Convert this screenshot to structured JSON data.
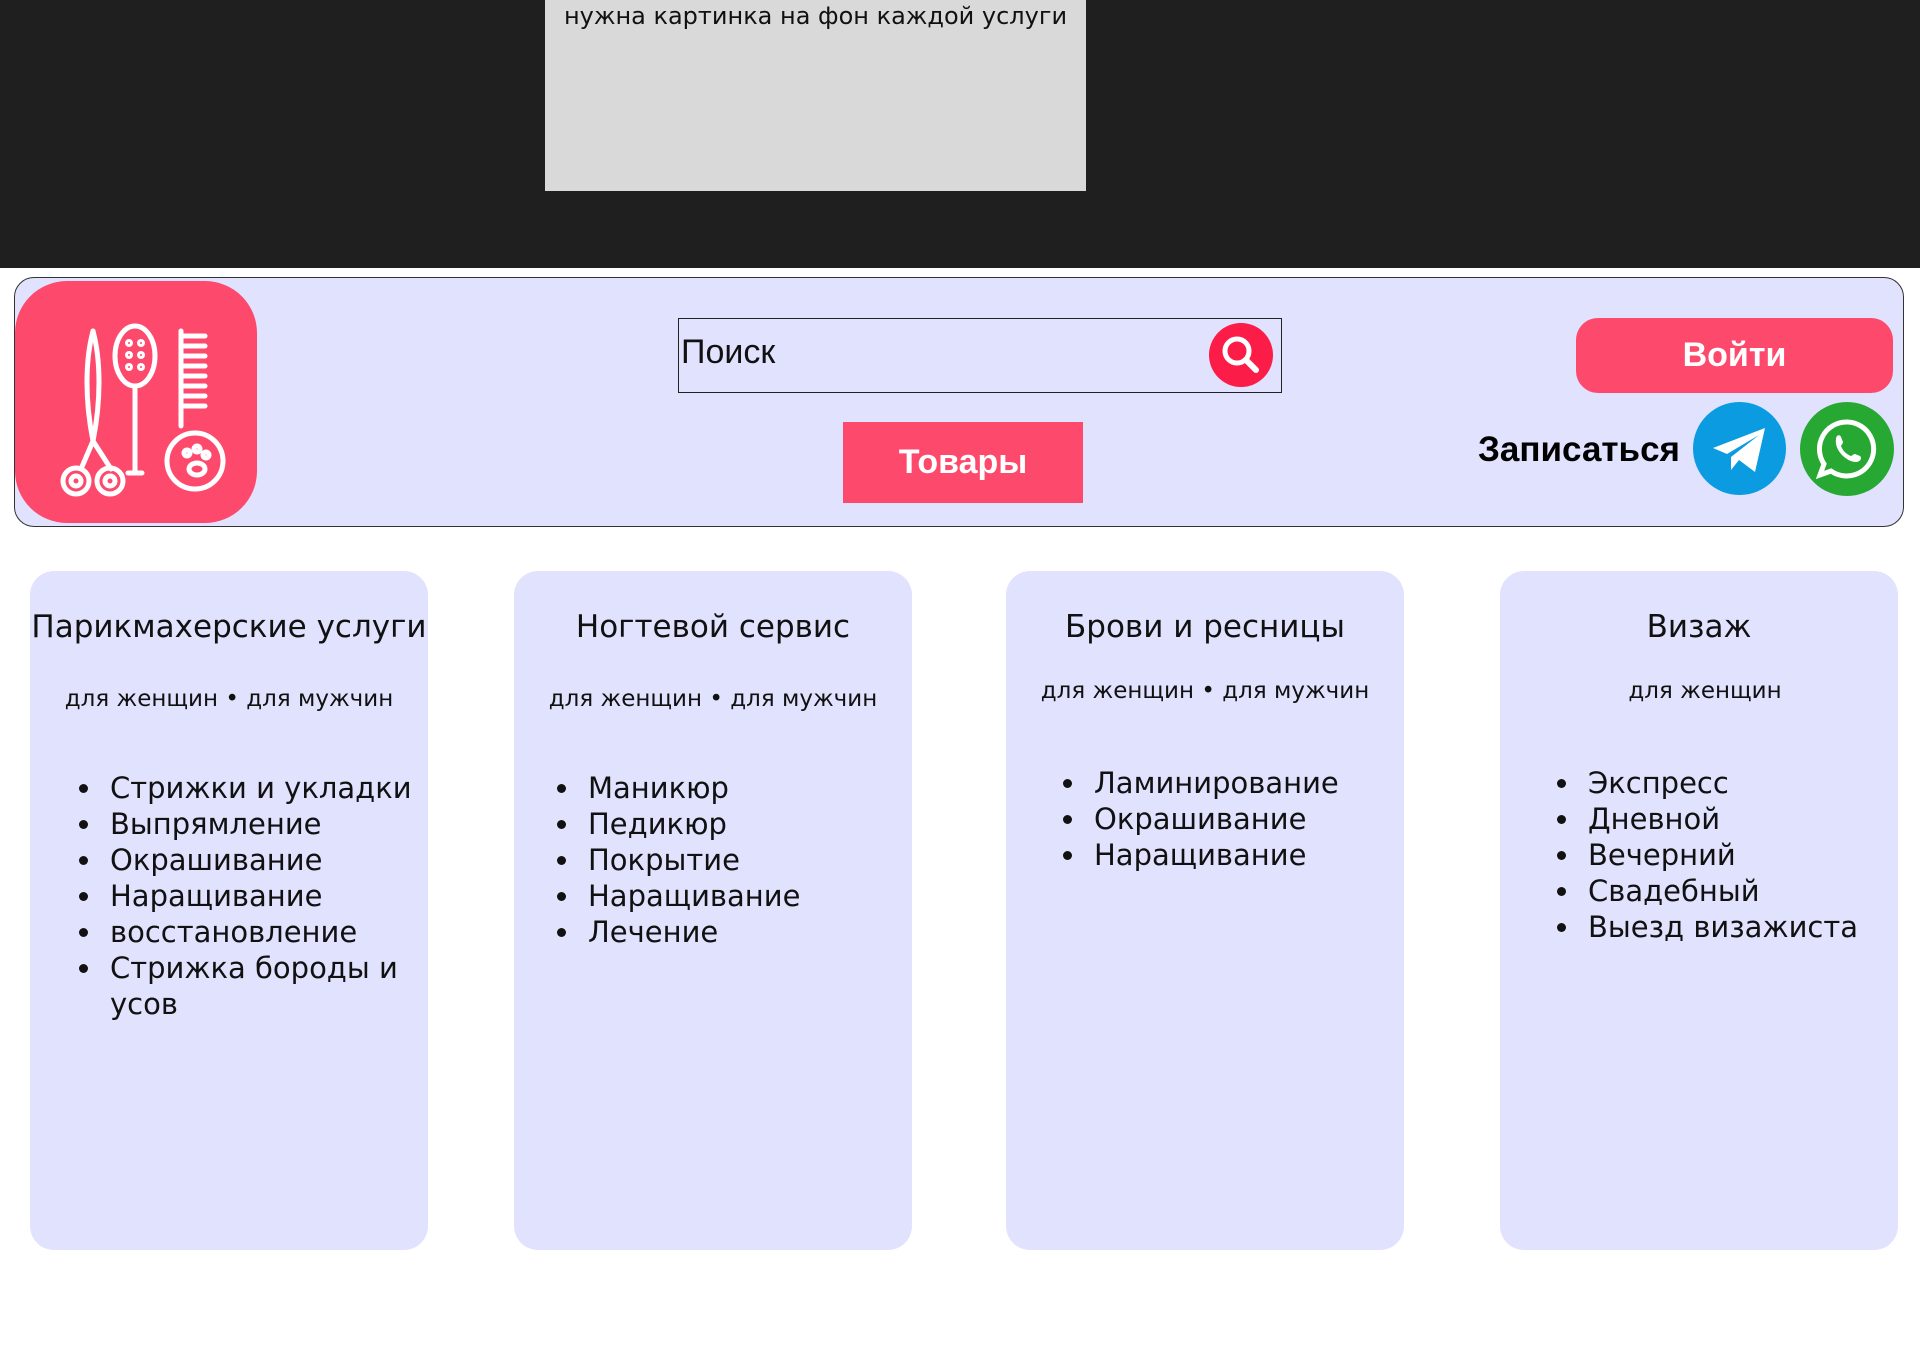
{
  "top_note": "нужна картинка на фон каждой услуги",
  "search": {
    "placeholder": "Поиск"
  },
  "nav": {
    "goods_label": "Товары",
    "login_label": "Войти",
    "book_label": "Записаться"
  },
  "colors": {
    "accent": "#fd4a6c",
    "panel": "#e0e2fe",
    "telegram": "#0a9be0",
    "whatsapp": "#27a832",
    "dark_band": "#1f1f1f"
  },
  "icons": {
    "logo": "barber-tools-icon",
    "search": "search-icon",
    "telegram": "telegram-icon",
    "whatsapp": "whatsapp-icon"
  },
  "services": [
    {
      "title": "Парикмахерские услуги",
      "subtitle": "для женщин • для мужчин",
      "items": [
        "Стрижки и укладки",
        "Выпрямление",
        "Окрашивание",
        "Наращивание",
        "восстановление",
        "Стрижка бороды и усов"
      ]
    },
    {
      "title": "Ногтевой сервис",
      "subtitle": "для женщин • для мужчин",
      "items": [
        "Маникюр",
        "Педикюр",
        "Покрытие",
        "Наращивание",
        "Лечение"
      ]
    },
    {
      "title": "Брови и ресницы",
      "subtitle": "для женщин • для мужчин",
      "items": [
        "Ламинирование",
        "Окрашивание",
        "Наращивание"
      ]
    },
    {
      "title": "Визаж",
      "subtitle": "для женщин",
      "items": [
        "Экспресс",
        "Дневной",
        "Вечерний",
        "Свадебный",
        "Выезд визажиста"
      ]
    }
  ]
}
